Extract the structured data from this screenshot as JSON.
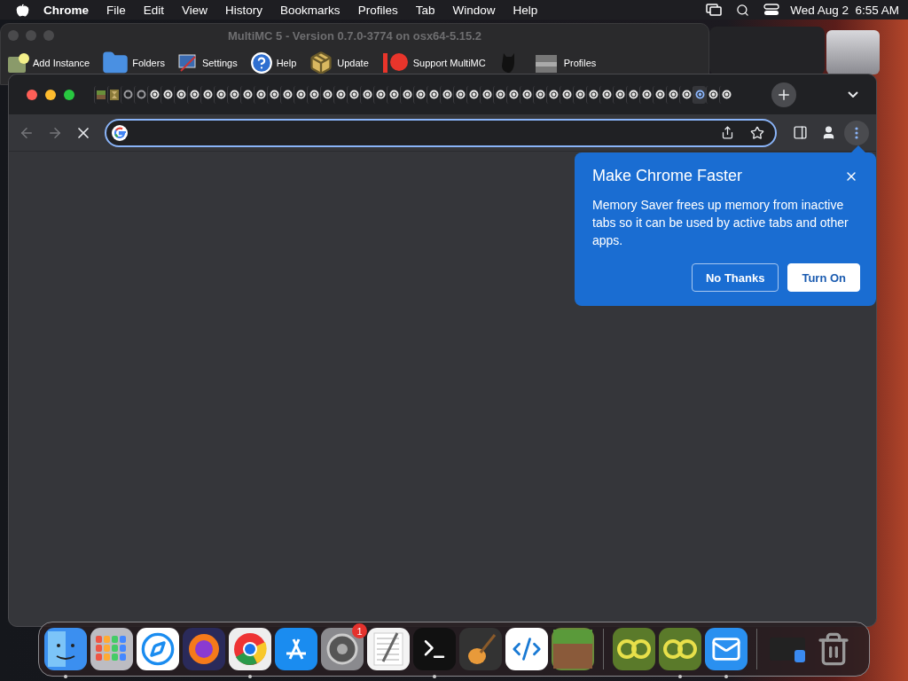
{
  "menu_bar": {
    "app": "Chrome",
    "items": [
      "File",
      "Edit",
      "View",
      "History",
      "Bookmarks",
      "Profiles",
      "Tab",
      "Window",
      "Help"
    ],
    "clock": "Wed Aug 2  6:55 AM"
  },
  "background_window": {
    "title": "MultiMC 5 - Version 0.7.0-3774 on osx64-5.15.2",
    "toolbar": [
      {
        "kind": "star",
        "label": "Add Instance"
      },
      {
        "kind": "folder",
        "label": "Folders"
      },
      {
        "kind": "settings",
        "label": "Settings"
      },
      {
        "kind": "help",
        "label": "Help"
      },
      {
        "kind": "update",
        "label": "Update"
      },
      {
        "kind": "patreon",
        "label": "Support MultiMC"
      },
      {
        "kind": "cat"
      },
      {
        "kind": "profile",
        "label": "Profiles"
      }
    ]
  },
  "browser": {
    "tabs": [
      {
        "kind": "block",
        "selected": false
      },
      {
        "kind": "grass",
        "selected": false
      },
      {
        "kind": "loading",
        "selected": false
      },
      {
        "kind": "loading",
        "selected": false
      },
      {
        "kind": "page",
        "selected": false
      },
      {
        "kind": "page",
        "selected": false
      },
      {
        "kind": "page",
        "selected": false
      },
      {
        "kind": "page",
        "selected": false
      },
      {
        "kind": "page",
        "selected": false
      },
      {
        "kind": "page",
        "selected": false
      },
      {
        "kind": "page",
        "selected": false
      },
      {
        "kind": "page",
        "selected": false
      },
      {
        "kind": "page",
        "selected": false
      },
      {
        "kind": "page",
        "selected": false
      },
      {
        "kind": "page",
        "selected": false
      },
      {
        "kind": "page",
        "selected": false
      },
      {
        "kind": "page",
        "selected": false
      },
      {
        "kind": "page",
        "selected": false
      },
      {
        "kind": "page",
        "selected": false
      },
      {
        "kind": "page",
        "selected": false
      },
      {
        "kind": "page",
        "selected": false
      },
      {
        "kind": "page",
        "selected": false
      },
      {
        "kind": "page",
        "selected": false
      },
      {
        "kind": "page",
        "selected": false
      },
      {
        "kind": "page",
        "selected": false
      },
      {
        "kind": "page",
        "selected": false
      },
      {
        "kind": "page",
        "selected": false
      },
      {
        "kind": "page",
        "selected": false
      },
      {
        "kind": "page",
        "selected": false
      },
      {
        "kind": "page",
        "selected": false
      },
      {
        "kind": "page",
        "selected": false
      },
      {
        "kind": "page",
        "selected": false
      },
      {
        "kind": "page",
        "selected": false
      },
      {
        "kind": "page",
        "selected": false
      },
      {
        "kind": "page",
        "selected": false
      },
      {
        "kind": "page",
        "selected": false
      },
      {
        "kind": "page",
        "selected": false
      },
      {
        "kind": "page",
        "selected": false
      },
      {
        "kind": "page",
        "selected": false
      },
      {
        "kind": "page",
        "selected": false
      },
      {
        "kind": "page",
        "selected": false
      },
      {
        "kind": "page",
        "selected": false
      },
      {
        "kind": "page",
        "selected": false
      },
      {
        "kind": "page",
        "selected": false
      },
      {
        "kind": "page",
        "selected": false
      },
      {
        "kind": "page",
        "selected": true
      },
      {
        "kind": "page",
        "selected": false
      },
      {
        "kind": "page",
        "selected": false
      }
    ],
    "nav": {
      "back_disabled": true,
      "forward_disabled": true
    },
    "menu_highlighted": true,
    "popup": {
      "title": "Make Chrome Faster",
      "body": "Memory Saver frees up memory from inactive tabs so it can be used by active tabs and other apps.",
      "buttons": [
        {
          "kind": "secondary",
          "label": "No Thanks"
        },
        {
          "kind": "primary",
          "label": "Turn On"
        }
      ]
    }
  },
  "dock": [
    {
      "kind": "finder",
      "running": true
    },
    {
      "kind": "launchpad",
      "running": false
    },
    {
      "kind": "safari",
      "running": false
    },
    {
      "kind": "firefox",
      "running": false
    },
    {
      "kind": "chrome",
      "running": true
    },
    {
      "kind": "appstore",
      "running": false
    },
    {
      "kind": "settings",
      "running": false,
      "badge": "1"
    },
    {
      "kind": "textedit",
      "running": false
    },
    {
      "kind": "terminal",
      "running": true
    },
    {
      "kind": "guitar",
      "running": false
    },
    {
      "kind": "vscode",
      "running": false
    },
    {
      "kind": "grass",
      "running": false
    },
    {
      "kind": "divider"
    },
    {
      "kind": "multimc",
      "running": false
    },
    {
      "kind": "multimc",
      "running": true
    },
    {
      "kind": "mail",
      "running": true
    },
    {
      "kind": "divider"
    },
    {
      "kind": "downloads",
      "running": false
    },
    {
      "kind": "trash",
      "running": false
    }
  ]
}
